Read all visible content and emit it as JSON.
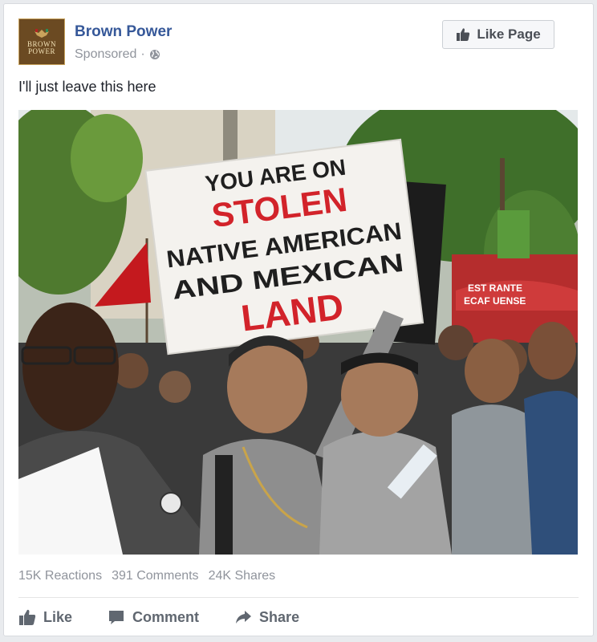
{
  "post": {
    "page_name": "Brown Power",
    "avatar_text": "BROWN\nPOWER",
    "sponsored": "Sponsored",
    "separator": "·",
    "like_page_label": "Like Page",
    "text": "I'll just leave this here"
  },
  "photo": {
    "sign_lines": [
      "YOU ARE ON",
      "STOLEN",
      "NATIVE AMERICAN",
      "AND MEXICAN",
      "LAND"
    ],
    "sign_colors": {
      "dark": "#1f1f1f",
      "red": "#d2232a"
    },
    "storefront_text": [
      "EST  RANTE",
      "ECAF  UENSE"
    ]
  },
  "stats": {
    "reactions": "15K Reactions",
    "comments": "391 Comments",
    "shares": "24K Shares"
  },
  "actions": {
    "like": "Like",
    "comment": "Comment",
    "share": "Share"
  },
  "colors": {
    "link": "#365899",
    "muted": "#90949c",
    "action": "#606770"
  }
}
